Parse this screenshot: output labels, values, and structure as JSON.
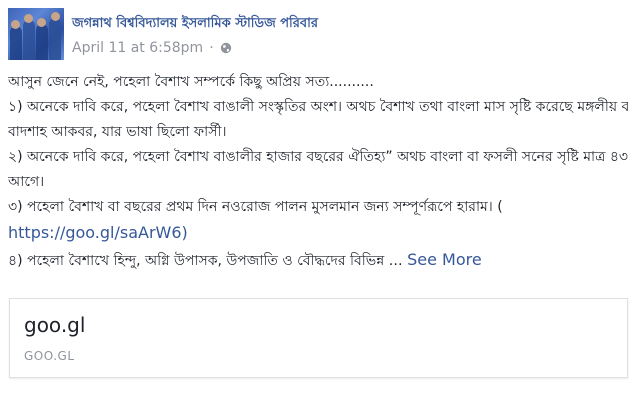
{
  "post": {
    "page_name": "জগন্নাথ বিশ্ববিদ্যালয় ইসলামিক স্টাডিজ পরিবার",
    "timestamp": "April 11 at 6:58pm",
    "separator": "·",
    "privacy_icon": "globe-icon",
    "lines": [
      "আসুন জেনে নেই, পহেলা বৈশাখ সম্পর্কে কিছু অপ্রিয় সত্য..........",
      "১) অনেকে দাবি করে, পহেলা বৈশাখ বাঙালী সংস্কৃতির অংশ। অথচ বৈশাখ তথা বাংলা মাস সৃষ্টি করেছে মঙ্গলীয় বংশোদ্ভূত",
      "বাদশাহ আকবর, যার ভাষা ছিলো ফার্সী।",
      "২) অনেকে দাবি করে, পহেলা বৈশাখ বাঙালীর হাজার বছরের ঐতিহ্য” অথচ বাংলা বা ফসলী সনের সৃষ্টি মাত্র ৪৩০ বছর",
      "আগে।",
      "৩) পহেলা বৈশাখ বা বছরের প্রথম দিন নওরোজ পালন মুসলমান জন্য সম্পূর্ণরূপে হারাম। ("
    ],
    "link_text": "https://goo.gl/saArW6)",
    "last_line": "৪) পহেলা বৈশাখে হিন্দু, অগ্নি উপাসক, উপজাতি ও বৌদ্ধদের বিভিন্ন …",
    "see_more_label": "See More"
  },
  "link_card": {
    "title": "goo.gl",
    "domain": "GOO.GL"
  }
}
